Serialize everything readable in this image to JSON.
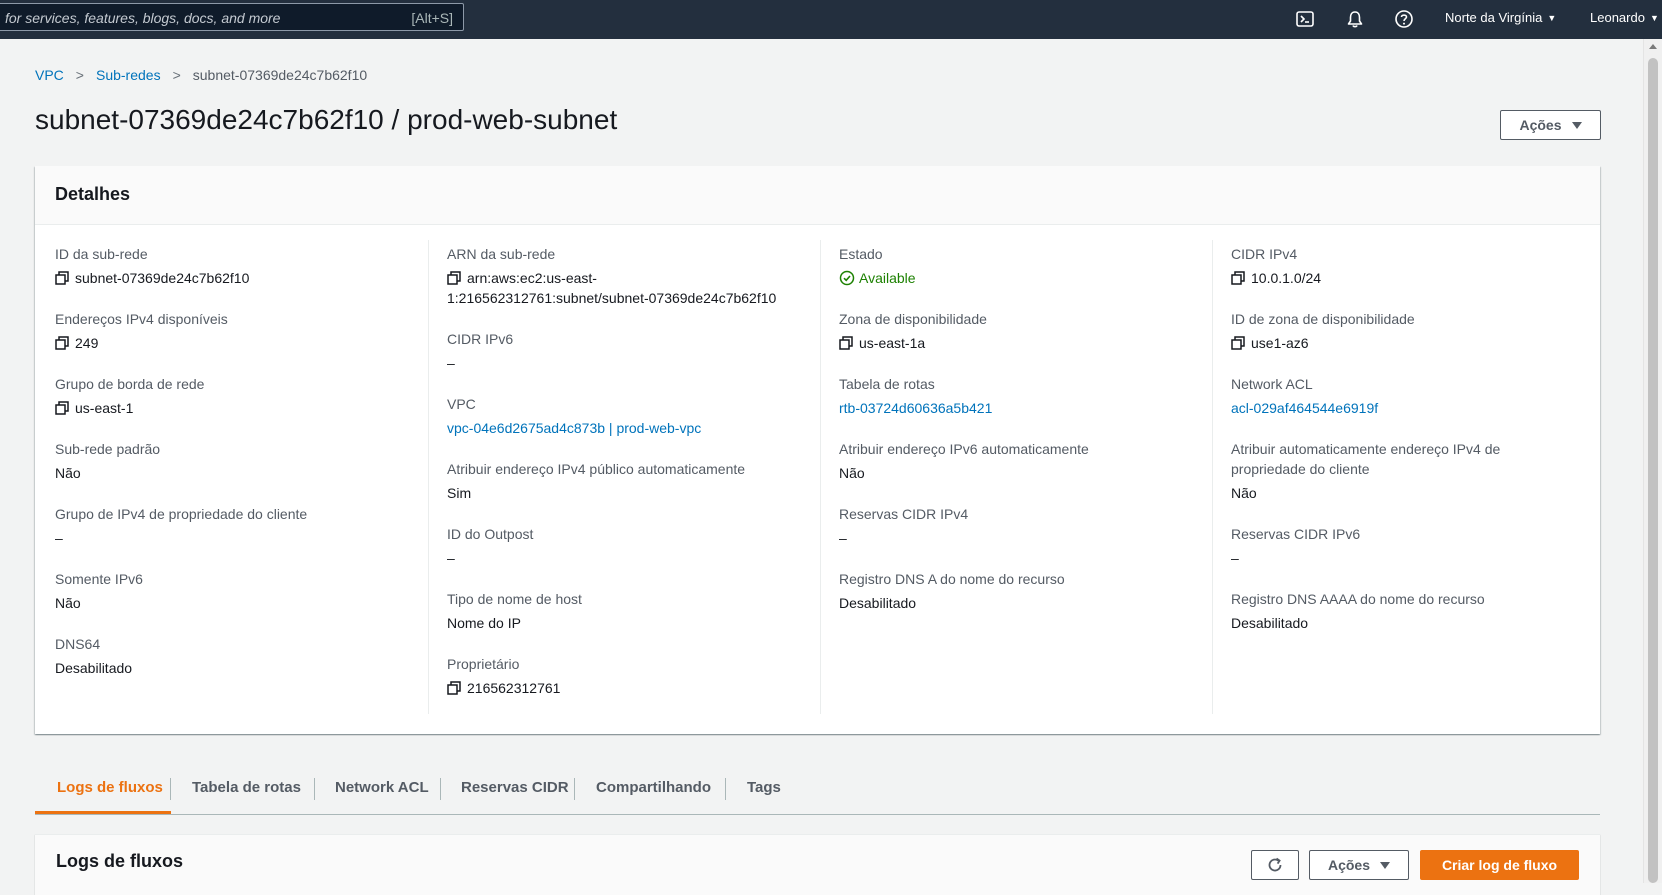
{
  "topnav": {
    "search_placeholder": "for services, features, blogs, docs, and more",
    "search_shortcut": "[Alt+S]",
    "region": "Norte da Virgínia",
    "user": "Leonardo"
  },
  "breadcrumb": {
    "items": [
      "VPC",
      "Sub-redes"
    ],
    "current": "subnet-07369de24c7b62f10"
  },
  "page_title": "subnet-07369de24c7b62f10 / prod-web-subnet",
  "actions_label": "Ações",
  "details": {
    "title": "Detalhes",
    "columns": [
      [
        {
          "label": "ID da sub-rede",
          "value": "subnet-07369de24c7b62f10",
          "copy": true
        },
        {
          "label": "Endereços IPv4 disponíveis",
          "value": "249",
          "copy": true
        },
        {
          "label": "Grupo de borda de rede",
          "value": "us-east-1",
          "copy": true
        },
        {
          "label": "Sub-rede padrão",
          "value": "Não"
        },
        {
          "label": "Grupo de IPv4 de propriedade do cliente",
          "value": "–"
        },
        {
          "label": "Somente IPv6",
          "value": "Não"
        },
        {
          "label": "DNS64",
          "value": "Desabilitado"
        }
      ],
      [
        {
          "label": "ARN da sub-rede",
          "value": "arn:aws:ec2:us-east-1:216562312761:subnet/subnet-07369de24c7b62f10",
          "copy": true,
          "value_line1": "arn:aws:ec2:us-east-",
          "value_line2": "1:216562312761:subnet/subnet-07369de24c7b62f10"
        },
        {
          "label": "CIDR IPv6",
          "value": "–"
        },
        {
          "label": "VPC",
          "value": "vpc-04e6d2675ad4c873b | prod-web-vpc",
          "link": true
        },
        {
          "label": "Atribuir endereço IPv4 público automaticamente",
          "value": "Sim"
        },
        {
          "label": "ID do Outpost",
          "value": "–"
        },
        {
          "label": "Tipo de nome de host",
          "value": "Nome do IP"
        },
        {
          "label": "Proprietário",
          "value": "216562312761",
          "copy": true
        }
      ],
      [
        {
          "label": "Estado",
          "value": "Available",
          "status": true
        },
        {
          "label": "Zona de disponibilidade",
          "value": "us-east-1a",
          "copy": true
        },
        {
          "label": "Tabela de rotas",
          "value": "rtb-03724d60636a5b421",
          "link": true
        },
        {
          "label": "Atribuir endereço IPv6 automaticamente",
          "value": "Não"
        },
        {
          "label": "Reservas CIDR IPv4",
          "value": "–"
        },
        {
          "label": "Registro DNS A do nome do recurso",
          "value": "Desabilitado"
        }
      ],
      [
        {
          "label": "CIDR IPv4",
          "value": "10.0.1.0/24",
          "copy": true
        },
        {
          "label": "ID de zona de disponibilidade",
          "value": "use1-az6",
          "copy": true
        },
        {
          "label": "Network ACL",
          "value": "acl-029af464544e6919f",
          "link": true
        },
        {
          "label": "Atribuir automaticamente endereço IPv4 de propriedade do cliente",
          "value": "Não",
          "label_line1": "Atribuir automaticamente endereço IPv4 de",
          "label_line2": "propriedade do cliente"
        },
        {
          "label": "Reservas CIDR IPv6",
          "value": "–"
        },
        {
          "label": "Registro DNS AAAA do nome do recurso",
          "value": "Desabilitado"
        }
      ]
    ]
  },
  "tabs": [
    "Logs de fluxos",
    "Tabela de rotas",
    "Network ACL",
    "Reservas CIDR",
    "Compartilhando",
    "Tags"
  ],
  "flowlogs": {
    "title": "Logs de fluxos",
    "actions_label": "Ações",
    "create_label": "Criar log de fluxo"
  },
  "colors": {
    "nav_bg": "#232f3e",
    "link": "#0073bb",
    "accent": "#ec7211",
    "status_ok": "#1d8102"
  }
}
